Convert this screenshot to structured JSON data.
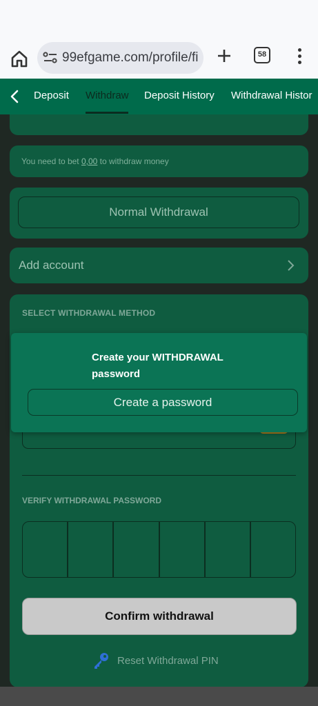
{
  "browser": {
    "url": "99efgame.com/profile/fi",
    "tab_count": "58"
  },
  "nav": {
    "tabs": [
      {
        "label": "Deposit"
      },
      {
        "label": "Withdraw"
      },
      {
        "label": "Deposit History"
      },
      {
        "label": "Withdrawal Histor"
      }
    ]
  },
  "bet_notice": {
    "prefix": "You need to bet ",
    "amount": "0,00",
    "suffix": " to withdraw money"
  },
  "withdraw_type": "Normal Withdrawal",
  "add_account": "Add account",
  "method": {
    "title": "SELECT WITHDRAWAL METHOD",
    "verify_title": "VERIFY WITHDRAWAL PASSWORD",
    "confirm_label": "Confirm withdrawal",
    "reset_label": "Reset Withdrawal PIN"
  },
  "dialog": {
    "title": "Create your WITHDRAWAL password",
    "button": "Create a password"
  },
  "colors": {
    "nav_bg": "#006b4b",
    "card_bg": "#0f5c40",
    "dialog_bg": "#0b7455",
    "confirm_bg": "#c9c9c9"
  }
}
